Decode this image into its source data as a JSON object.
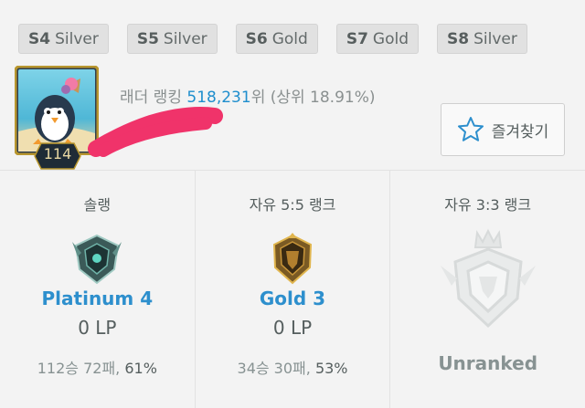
{
  "seasons": [
    {
      "season": "S4",
      "tier": "Silver"
    },
    {
      "season": "S5",
      "tier": "Silver"
    },
    {
      "season": "S6",
      "tier": "Gold"
    },
    {
      "season": "S7",
      "tier": "Gold"
    },
    {
      "season": "S8",
      "tier": "Silver"
    }
  ],
  "profile": {
    "level": "114",
    "ladder_prefix": "래더 랭킹 ",
    "ladder_rank": "518,231",
    "ladder_suffix": "위 (상위 18.91%)"
  },
  "favorite": {
    "label": "즐겨찾기",
    "icon": "star-outline-icon"
  },
  "ranks": [
    {
      "title": "솔랭",
      "tier": "Platinum 4",
      "lp": "0 LP",
      "record": "112승 72패, ",
      "ratio": "61%",
      "emblem": "platinum-emblem-icon"
    },
    {
      "title": "자유 5:5 랭크",
      "tier": "Gold 3",
      "lp": "0 LP",
      "record": "34승 30패, ",
      "ratio": "53%",
      "emblem": "gold-emblem-icon"
    },
    {
      "title": "자유 3:3 랭크",
      "status": "Unranked",
      "emblem": "unranked-emblem-icon"
    }
  ],
  "colors": {
    "accent": "#1f8ecd",
    "tier_text": "#2d8fcd",
    "redaction": "#f0336a"
  }
}
